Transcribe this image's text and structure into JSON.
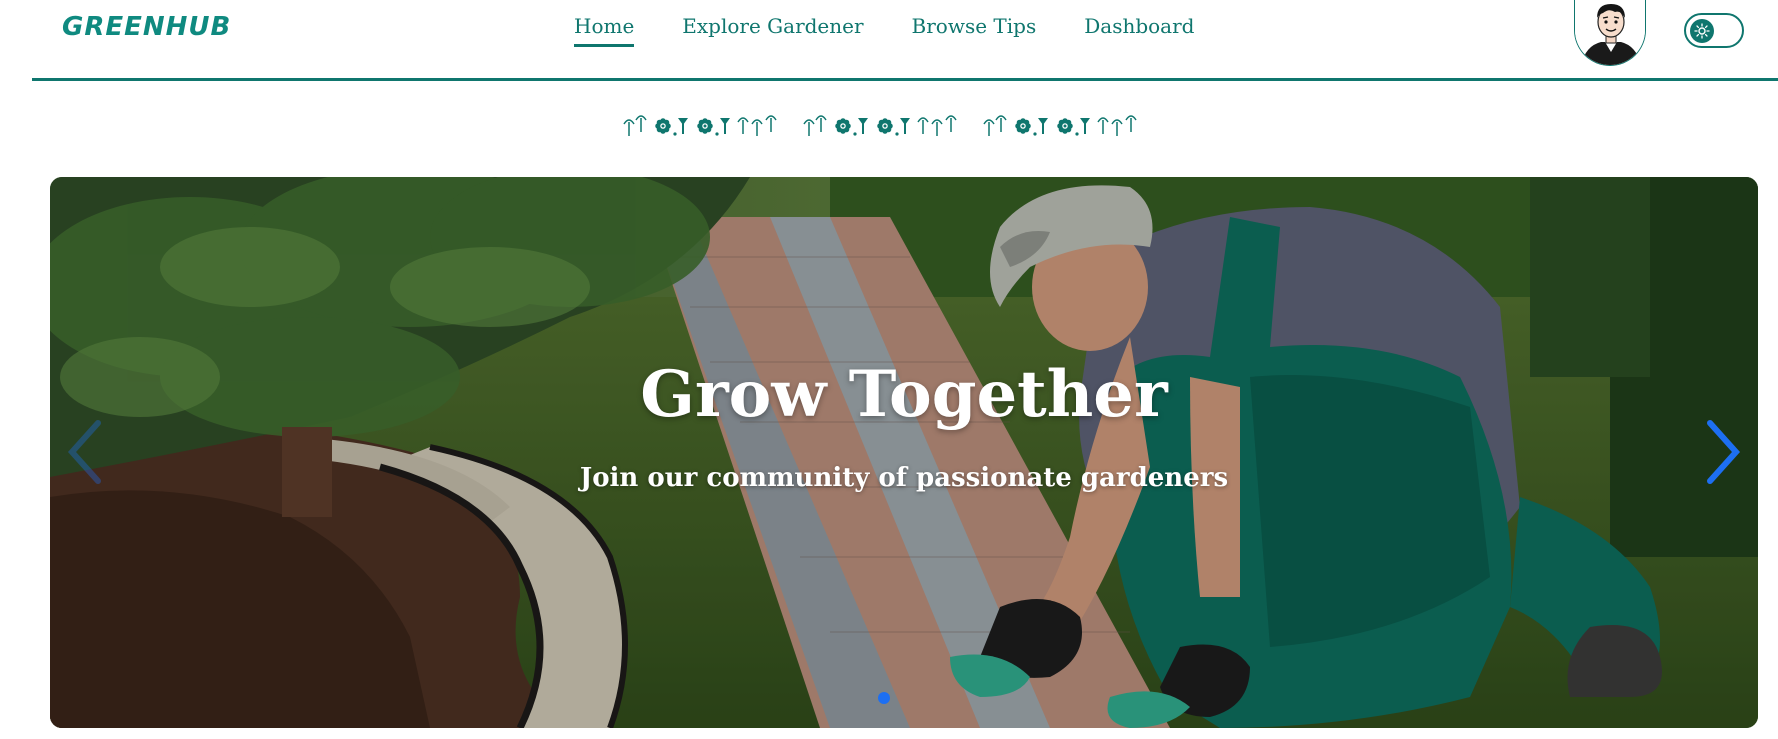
{
  "brand": {
    "logo_text": "GREENHUB"
  },
  "nav": {
    "items": [
      {
        "label": "Home",
        "active": true
      },
      {
        "label": "Explore Gardener",
        "active": false
      },
      {
        "label": "Browse Tips",
        "active": false
      },
      {
        "label": "Dashboard",
        "active": false
      }
    ]
  },
  "header": {
    "avatar_icon": "user-avatar",
    "theme_toggle_icon": "sun-icon"
  },
  "ornament": {
    "icon": "floral-border-divider"
  },
  "hero": {
    "title": "Grow Together",
    "subtitle": "Join our community of passionate gardeners",
    "prev_icon": "chevron-left-icon",
    "next_icon": "chevron-right-icon",
    "slide_count": 1,
    "active_slide": 1
  },
  "colors": {
    "brand": "#0f766e",
    "accent_blue": "#1d6ff2",
    "white": "#ffffff"
  }
}
